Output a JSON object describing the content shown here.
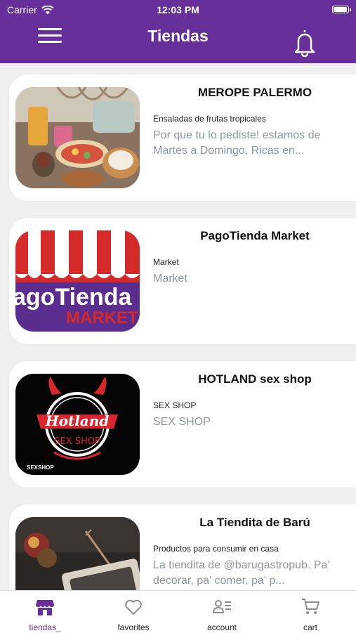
{
  "status_bar": {
    "carrier": "Carrier",
    "time": "12:03 PM"
  },
  "header": {
    "title": "Tiendas",
    "menu_icon": "hamburger-icon",
    "bell_icon": "bell-icon"
  },
  "stores": [
    {
      "name": "MEROPE PALERMO",
      "category": "Ensaladas de frutas tropicales",
      "description": "Por que tu lo pediste! estamos de Martes a Domingo, Ricas en..."
    },
    {
      "name": "PagoTienda Market",
      "category": "Market",
      "description": "Market"
    },
    {
      "name": "HOTLAND sex shop",
      "category": "SEX SHOP",
      "description": "SEX SHOP"
    },
    {
      "name": "La Tiendita de Barú",
      "category": "Productos para consumir en casa",
      "description": "La tiendita de @barugastropub. Pa' decorar, pa' comer, pa' p..."
    }
  ],
  "logos": {
    "pago": {
      "line1": "agoTienda",
      "line2": "MARKET"
    },
    "hotland": {
      "brand": "Hotland",
      "sub": "SEX SHOP",
      "corner": "SEXSHOP"
    }
  },
  "tabs": [
    {
      "label": "tiendas_",
      "icon": "store-icon"
    },
    {
      "label": "favorites",
      "icon": "heart-icon"
    },
    {
      "label": "account",
      "icon": "account-icon"
    },
    {
      "label": "cart",
      "icon": "cart-icon"
    }
  ],
  "colors": {
    "brand": "#672f9a",
    "muted_text": "#8b96a3",
    "background": "#efeff0"
  }
}
